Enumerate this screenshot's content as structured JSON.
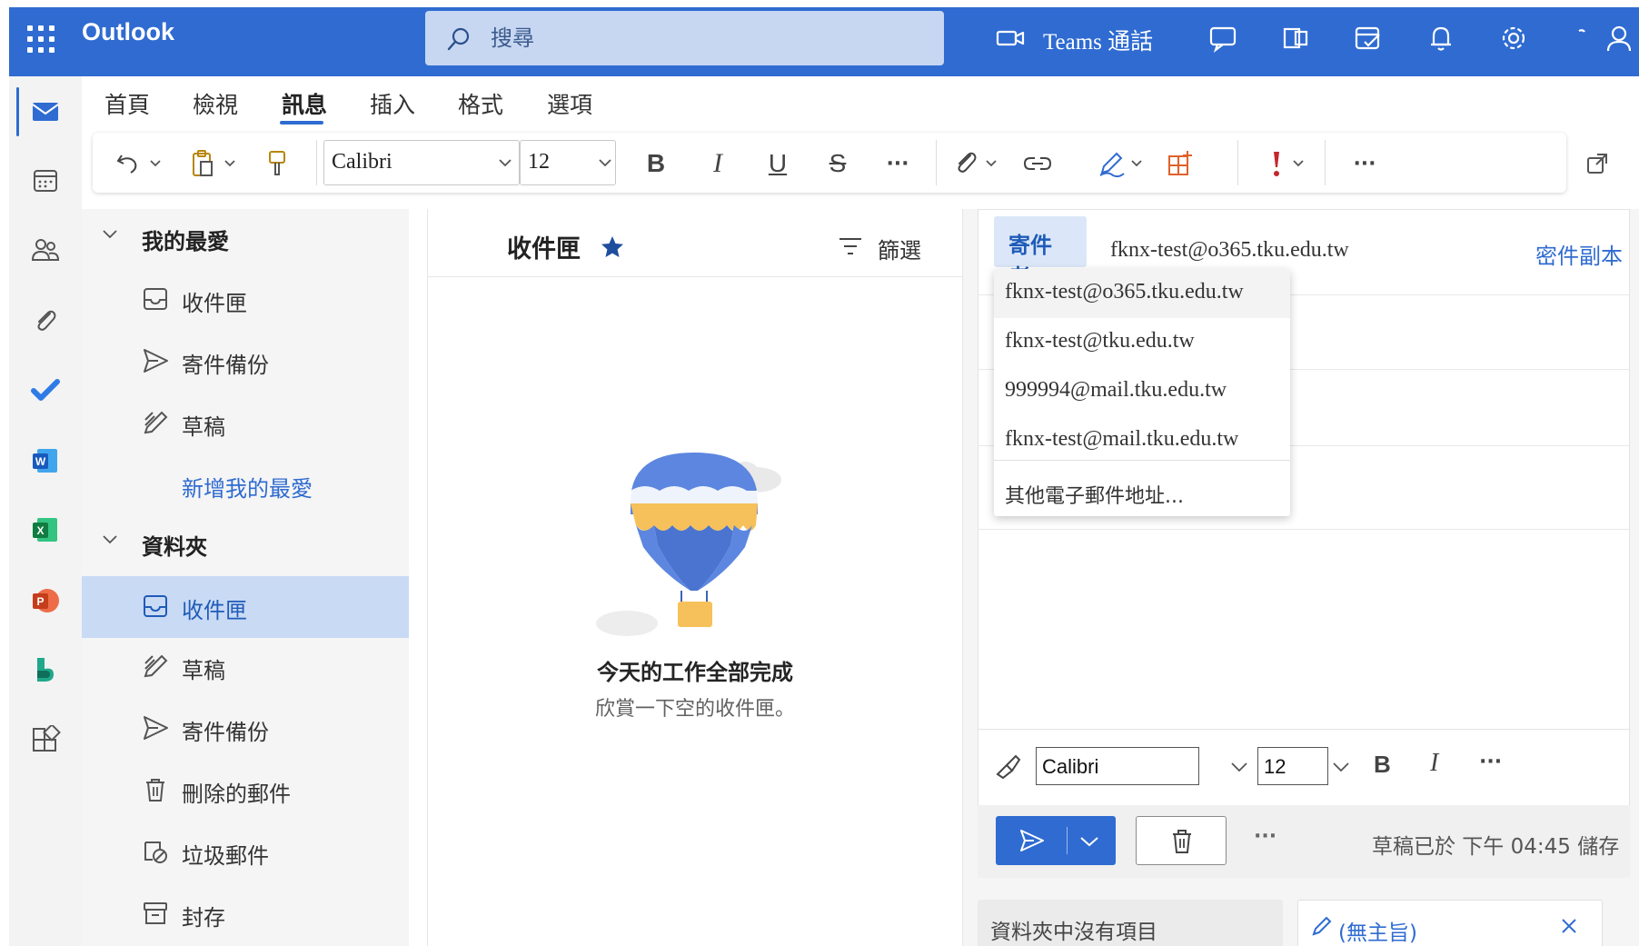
{
  "app": {
    "title": "Outlook"
  },
  "header": {
    "search_placeholder": "搜尋",
    "teams_call_label": "Teams 通話",
    "icons": [
      "waffle-icon",
      "video-icon",
      "chat-icon",
      "office-icon",
      "calendar-check-icon",
      "bell-icon",
      "gear-icon",
      "help-icon",
      "person-icon"
    ]
  },
  "rail": {
    "items": [
      "mail-icon",
      "calendar-icon",
      "people-icon",
      "attachment-icon",
      "todo-icon",
      "word-icon",
      "excel-icon",
      "powerpoint-icon",
      "bookings-icon",
      "apps-icon"
    ]
  },
  "ribbon": {
    "tabs": [
      "首頁",
      "檢視",
      "訊息",
      "插入",
      "格式",
      "選項"
    ],
    "active_tab": "訊息",
    "font_name": "Calibri",
    "font_size": "12",
    "bold_label": "B",
    "italic_label": "I",
    "underline_label": "U",
    "strike_label": "S",
    "more_label": "···"
  },
  "folders": {
    "favorites_label": "我的最愛",
    "favorites": [
      {
        "label": "收件匣",
        "icon": "inbox-icon"
      },
      {
        "label": "寄件備份",
        "icon": "send-icon"
      },
      {
        "label": "草稿",
        "icon": "drafts-icon"
      }
    ],
    "add_favorite": "新增我的最愛",
    "folders_label": "資料夾",
    "items": [
      {
        "label": "收件匣",
        "icon": "inbox-icon",
        "selected": true
      },
      {
        "label": "草稿",
        "icon": "drafts-icon"
      },
      {
        "label": "寄件備份",
        "icon": "send-icon"
      },
      {
        "label": "刪除的郵件",
        "icon": "trash-icon"
      },
      {
        "label": "垃圾郵件",
        "icon": "junk-icon"
      },
      {
        "label": "封存",
        "icon": "archive-icon"
      }
    ]
  },
  "message_list": {
    "title": "收件匣",
    "filter_label": "篩選",
    "empty_title": "今天的工作全部完成",
    "empty_subtitle": "欣賞一下空的收件匣。"
  },
  "compose": {
    "from_label": "寄件者",
    "from_value": "fknx-test@o365.tku.edu.tw",
    "bcc_label": "密件副本",
    "from_options": [
      "fknx-test@o365.tku.edu.tw",
      "fknx-test@tku.edu.tw",
      "999994@mail.tku.edu.tw",
      "fknx-test@mail.tku.edu.tw"
    ],
    "other_address": "其他電子郵件地址...",
    "format_font": "Calibri",
    "format_size": "12",
    "format_bold": "B",
    "format_italic": "I",
    "format_more": "···",
    "more_actions": "···",
    "saved_status": "草稿已於 下午 04:45 儲存"
  },
  "bottom_tabs": {
    "folder_empty": "資料夾中沒有項目",
    "draft_subject": "(無主旨)"
  },
  "colors": {
    "brand": "#2f6bd1",
    "selected_folder": "#c9daf5",
    "search_bg": "#c7d7f2"
  }
}
